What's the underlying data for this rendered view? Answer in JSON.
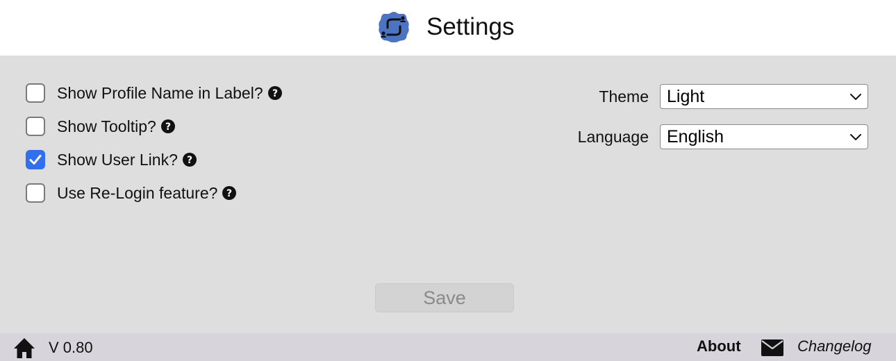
{
  "header": {
    "title": "Settings",
    "logo_icon": "profile-switch-logo-icon"
  },
  "options": [
    {
      "label": "Show Profile Name in Label?",
      "checked": false
    },
    {
      "label": "Show Tooltip?",
      "checked": false
    },
    {
      "label": "Show User Link?",
      "checked": true
    },
    {
      "label": "Use Re-Login feature?",
      "checked": false
    }
  ],
  "theme": {
    "label": "Theme",
    "value": "Light"
  },
  "language": {
    "label": "Language",
    "value": "English"
  },
  "save_label": "Save",
  "footer": {
    "version": "V 0.80",
    "about": "About",
    "changelog": "Changelog",
    "home_icon": "home-icon",
    "mail_icon": "mail-icon"
  },
  "colors": {
    "header_bg": "#ffffff",
    "panel_bg": "#dedede",
    "footer_bg": "#d7d5db",
    "checkbox_checked": "#2f6ff0",
    "logo_blue": "#4d73c3",
    "save_disabled_bg": "#d3d3d3",
    "save_disabled_text": "#8a8a8a"
  }
}
